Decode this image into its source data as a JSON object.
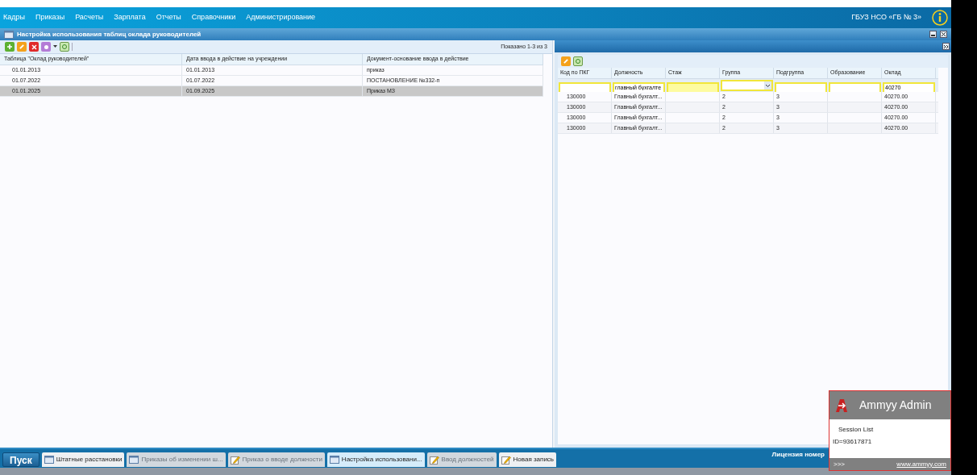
{
  "nav": {
    "menu": [
      "Кадры",
      "Приказы",
      "Расчеты",
      "Зарплата",
      "Отчеты",
      "Справочники",
      "Администрирование"
    ],
    "org": "ГБУЗ НСО «ГБ № 3»"
  },
  "window": {
    "title": "Настройка использования таблиц оклада руководителей"
  },
  "left": {
    "paging": "Показано 1-3 из 3",
    "columns": [
      "Таблица \"Оклад руководителей\"",
      "Дата ввода в действие на учреждении",
      "Документ-основание ввода в действие"
    ],
    "rows": [
      {
        "cells": [
          "01.01.2013",
          "01.01.2013",
          "приказ"
        ],
        "selected": false
      },
      {
        "cells": [
          "01.07.2022",
          "01.07.2022",
          "ПОСТАНОВЛЕНИЕ №332-п"
        ],
        "selected": false
      },
      {
        "cells": [
          "01.01.2025",
          "01.09.2025",
          "Приказ МЗ"
        ],
        "selected": true
      }
    ]
  },
  "right": {
    "columns": [
      "Код по ПКГ",
      "Должность",
      "Стаж",
      "Группа",
      "Подгруппа",
      "Образование",
      "Оклад"
    ],
    "filters": [
      {
        "kind": "text",
        "highlighted": false
      },
      {
        "kind": "text",
        "value": "главный бухгалте",
        "highlighted": false
      },
      {
        "kind": "text",
        "highlighted": true
      },
      {
        "kind": "select",
        "highlighted": false
      },
      {
        "kind": "text",
        "highlighted": false
      },
      {
        "kind": "text",
        "highlighted": false
      },
      {
        "kind": "text",
        "value": "40270",
        "highlighted": false
      }
    ],
    "rows": [
      [
        "130000",
        "Главный бухгалт...",
        "",
        "2",
        "3",
        "",
        "40270.00"
      ],
      [
        "130000",
        "Главный бухгалт...",
        "",
        "2",
        "3",
        "",
        "40270.00"
      ],
      [
        "130000",
        "Главный бухгалт...",
        "",
        "2",
        "3",
        "",
        "40270.00"
      ],
      [
        "130000",
        "Главный бухгалт...",
        "",
        "2",
        "3",
        "",
        "40270.00"
      ]
    ]
  },
  "taskbar": {
    "start": "Пуск",
    "tasks": [
      {
        "label": "Штатные расстановки",
        "kind": "list",
        "selected": false,
        "disabled": false
      },
      {
        "label": "Приказы об изменении ш...",
        "kind": "list",
        "selected": false,
        "disabled": true
      },
      {
        "label": "Приказ о вводе должности",
        "kind": "form",
        "selected": false,
        "disabled": true
      },
      {
        "label": "Настройка использовани...",
        "kind": "list",
        "selected": true,
        "disabled": false
      },
      {
        "label": "Ввод должностей",
        "kind": "form",
        "selected": false,
        "disabled": true
      },
      {
        "label": "Новая запись",
        "kind": "form",
        "selected": false,
        "disabled": false
      }
    ],
    "license": "Лицензия номер"
  },
  "popup": {
    "title": "Ammyy Admin",
    "session": "Session List",
    "id": "ID=93617871",
    "more": ">>>",
    "link": "www.ammyy.com"
  }
}
